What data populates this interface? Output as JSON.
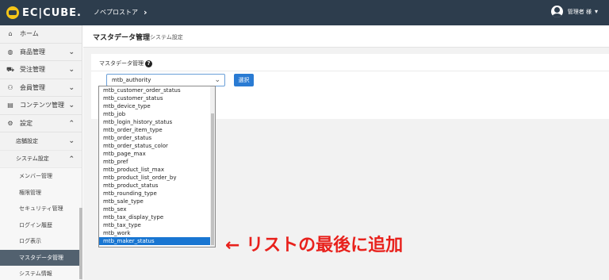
{
  "header": {
    "logo_text": "EC|CUBE.",
    "shop_name": "ノベプロストア",
    "shop_chevron": "›",
    "user_name": "管理者 様",
    "user_caret": "▾"
  },
  "sidebar": {
    "items": [
      {
        "label": "ホーム",
        "icon": "⌂",
        "arrow": ""
      },
      {
        "label": "商品管理",
        "icon": "◍",
        "arrow": "⌄"
      },
      {
        "label": "受注管理",
        "icon": "⛟",
        "arrow": "⌄"
      },
      {
        "label": "会員管理",
        "icon": "⚇",
        "arrow": "⌄"
      },
      {
        "label": "コンテンツ管理",
        "icon": "▤",
        "arrow": "⌄"
      },
      {
        "label": "設定",
        "icon": "⚙",
        "arrow": "⌃"
      }
    ],
    "sub_items": [
      {
        "label": "店舗設定",
        "arrow": "⌄"
      },
      {
        "label": "システム設定",
        "arrow": "⌃"
      }
    ],
    "leaves": [
      "メンバー管理",
      "権限管理",
      "セキュリティ管理",
      "ログイン履歴",
      "ログ表示",
      "マスタデータ管理",
      "システム情報"
    ],
    "active_leaf": "マスタデータ管理"
  },
  "page": {
    "title": "マスタデータ管理",
    "subtitle": "システム設定"
  },
  "form": {
    "label": "マスタデータ管理",
    "help": "?",
    "selected_value": "mtb_authority",
    "select_caret": "⌄",
    "button_label": "選択"
  },
  "dropdown_options": [
    "mtb_customer_order_status",
    "mtb_customer_status",
    "mtb_device_type",
    "mtb_job",
    "mtb_login_history_status",
    "mtb_order_item_type",
    "mtb_order_status",
    "mtb_order_status_color",
    "mtb_page_max",
    "mtb_pref",
    "mtb_product_list_max",
    "mtb_product_list_order_by",
    "mtb_product_status",
    "mtb_rounding_type",
    "mtb_sale_type",
    "mtb_sex",
    "mtb_tax_display_type",
    "mtb_tax_type",
    "mtb_work",
    "mtb_maker_status"
  ],
  "highlighted_option": "mtb_maker_status",
  "annotation": "← リストの最後に追加",
  "colors": {
    "topbar": "#2d3d4d",
    "accent": "#1976d2",
    "annotation": "#e8211c",
    "active_nav": "#52616f"
  }
}
